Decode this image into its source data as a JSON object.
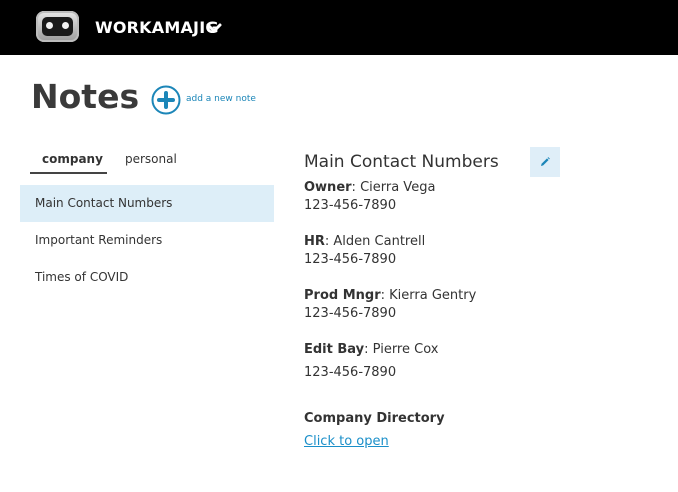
{
  "header": {
    "app_name": "WORKAMAJIG",
    "logo_icon": "robot-logo-icon",
    "menu_icon": "chevron-down-icon"
  },
  "page": {
    "title": "Notes",
    "add_note_label": "add a new note"
  },
  "tabs": [
    {
      "label": "company",
      "active": true
    },
    {
      "label": "personal",
      "active": false
    }
  ],
  "notes_list": [
    {
      "label": "Main Contact Numbers",
      "selected": true
    },
    {
      "label": "Important Reminders",
      "selected": false
    },
    {
      "label": "Times of COVID",
      "selected": false
    }
  ],
  "detail": {
    "title": "Main Contact Numbers",
    "edit_icon": "pencil-icon",
    "contacts": [
      {
        "role": "Owner",
        "name": "Cierra Vega",
        "phone": "123-456-7890"
      },
      {
        "role": "HR",
        "name": "Alden Cantrell",
        "phone": "123-456-7890"
      },
      {
        "role": "Prod Mngr",
        "name": "Kierra Gentry",
        "phone": "123-456-7890"
      },
      {
        "role": "Edit Bay",
        "name": "Pierre Cox",
        "phone": "123-456-7890"
      }
    ],
    "directory_title": "Company Directory",
    "directory_link": "Click to open"
  },
  "colors": {
    "topbar": "#000000",
    "accent": "#1c86b8",
    "selected_row": "#ddeef8"
  }
}
